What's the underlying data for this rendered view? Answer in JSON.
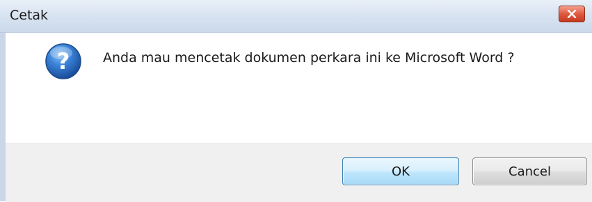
{
  "window": {
    "title": "Cetak",
    "close_icon": "close-icon"
  },
  "message": {
    "icon": "question-icon",
    "text": "Anda mau mencetak dokumen perkara ini ke Microsoft Word ?"
  },
  "buttons": {
    "ok_label": "OK",
    "cancel_label": "Cancel"
  },
  "colors": {
    "titlebar": "#d6e2f0",
    "close_button": "#e0583f",
    "icon_blue": "#2f6fc4",
    "footer": "#f0f0f0",
    "ok_border": "#3c7fb1"
  }
}
